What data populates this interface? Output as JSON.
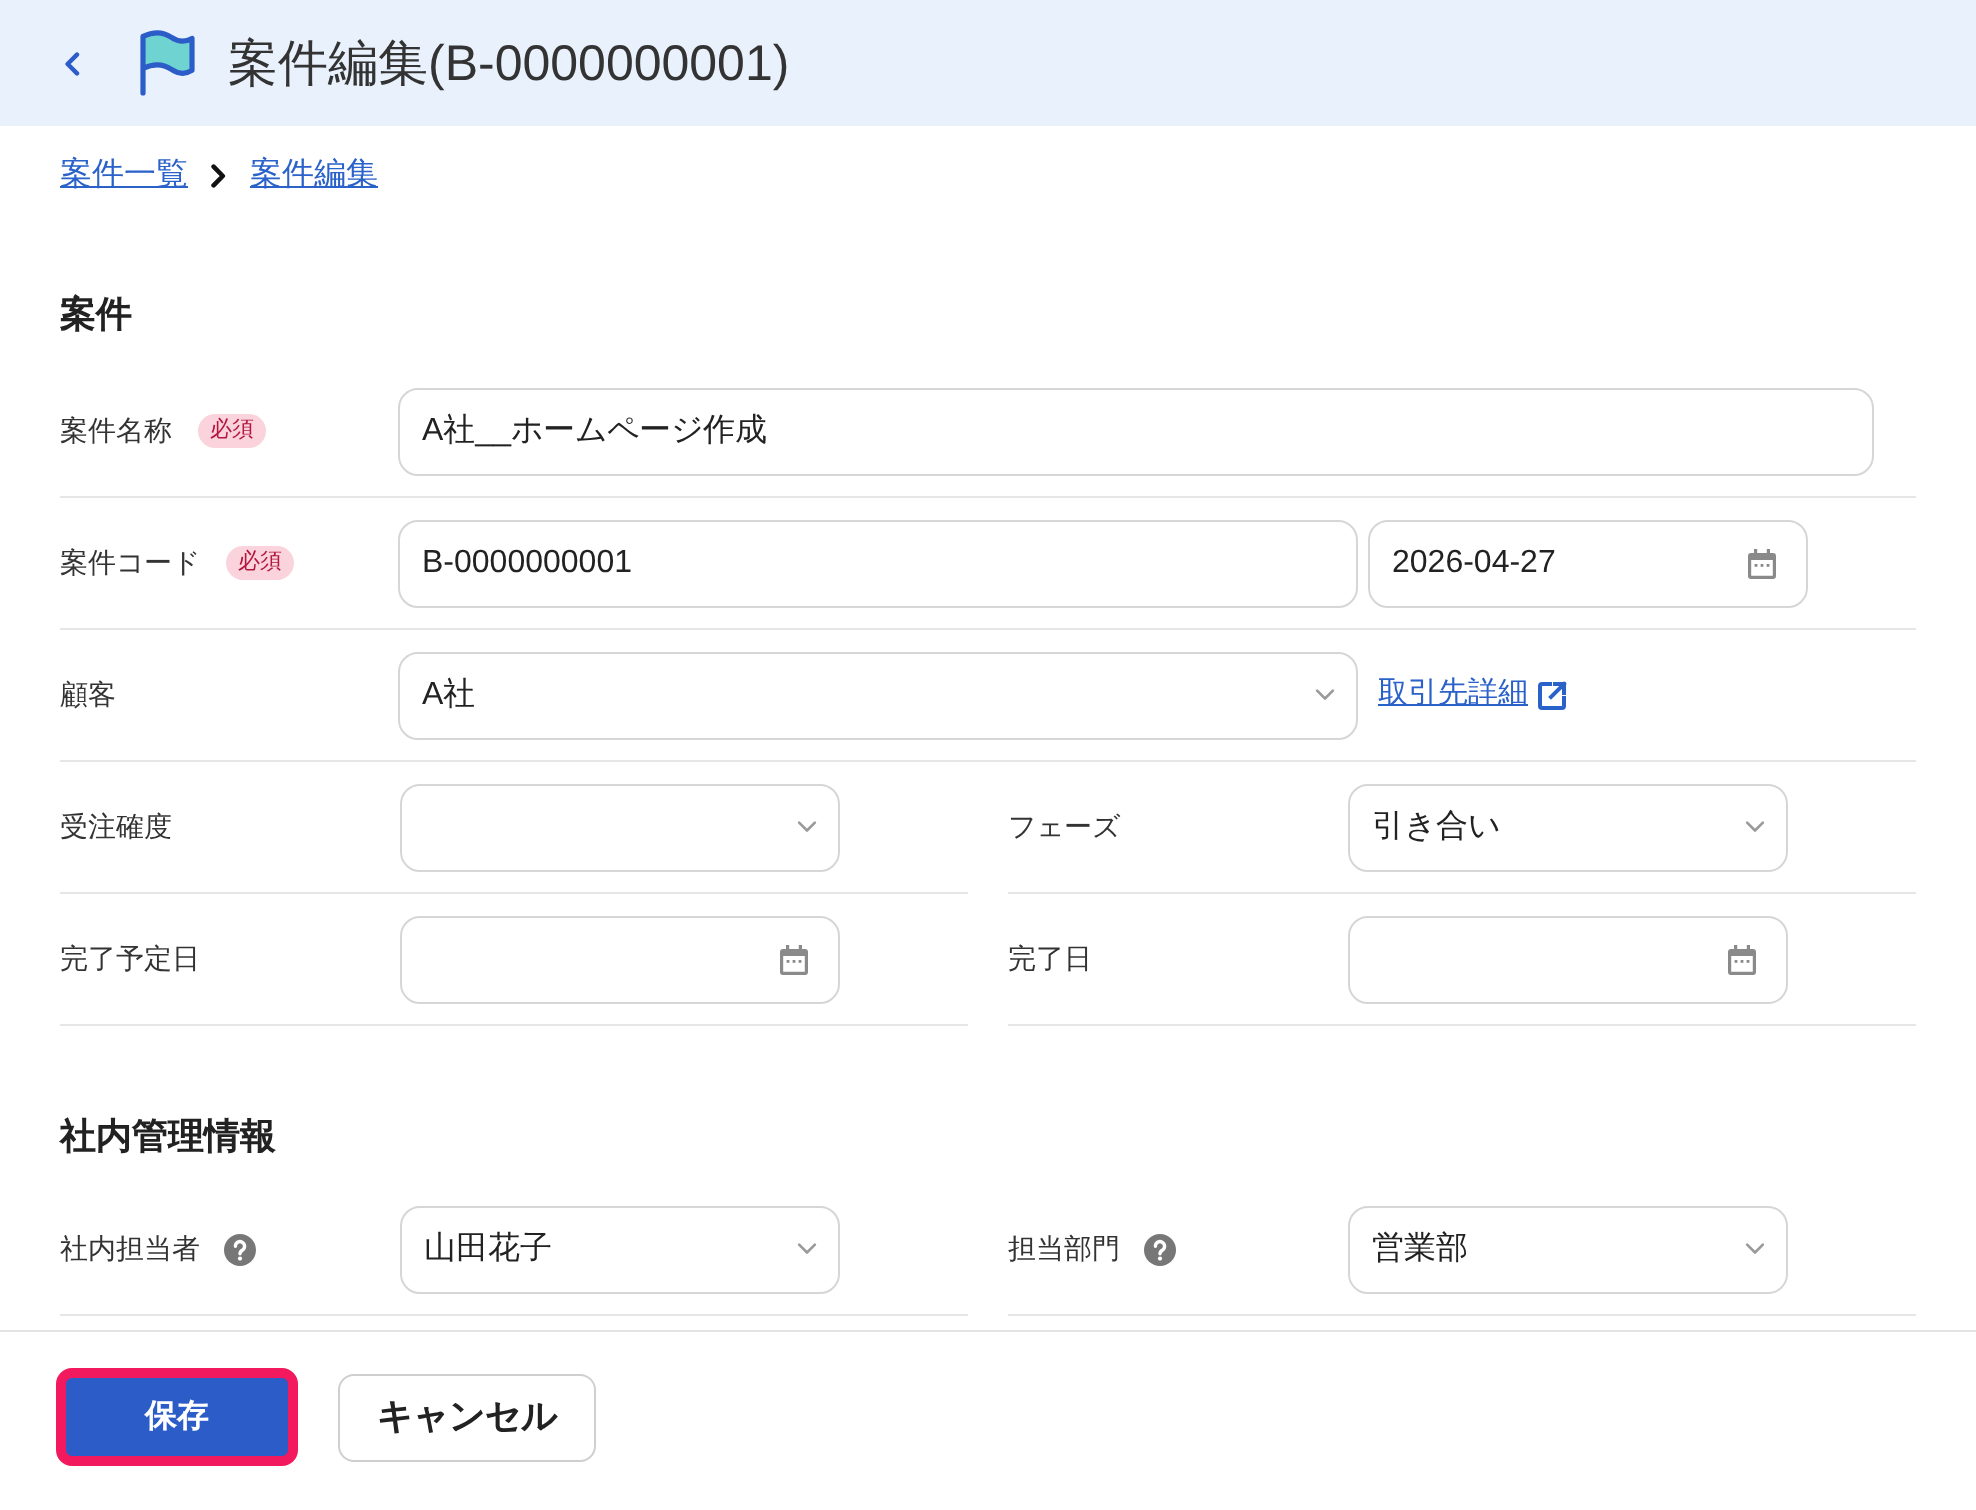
{
  "header": {
    "title": "案件編集(B-0000000001)"
  },
  "breadcrumb": [
    {
      "label": "案件一覧"
    },
    {
      "label": "案件編集"
    }
  ],
  "sections": [
    {
      "title": "案件",
      "rows": [
        {
          "kind": "single",
          "fields": [
            {
              "label": "案件名称",
              "required_badge": "必須",
              "controls": [
                {
                  "kind": "text",
                  "value": "A社__ホームページ作成"
                }
              ]
            }
          ]
        },
        {
          "kind": "single",
          "fields": [
            {
              "label": "案件コード",
              "required_badge": "必須",
              "controls": [
                {
                  "kind": "text",
                  "value": "B-0000000001"
                },
                {
                  "kind": "date",
                  "value": "2026-04-27"
                }
              ]
            }
          ]
        },
        {
          "kind": "single",
          "fields": [
            {
              "label": "顧客",
              "controls": [
                {
                  "kind": "select",
                  "value": "A社"
                },
                {
                  "kind": "link",
                  "label": "取引先詳細"
                }
              ]
            }
          ]
        },
        {
          "kind": "pair",
          "fields": [
            {
              "label": "受注確度",
              "controls": [
                {
                  "kind": "select"
                }
              ]
            },
            {
              "label": "フェーズ",
              "controls": [
                {
                  "kind": "select",
                  "value": "引き合い"
                }
              ]
            }
          ]
        },
        {
          "kind": "pair",
          "fields": [
            {
              "label": "完了予定日",
              "controls": [
                {
                  "kind": "date"
                }
              ]
            },
            {
              "label": "完了日",
              "controls": [
                {
                  "kind": "date"
                }
              ]
            }
          ]
        }
      ]
    },
    {
      "title": "社内管理情報",
      "rows": [
        {
          "kind": "pair",
          "fields": [
            {
              "label": "社内担当者",
              "help": true,
              "controls": [
                {
                  "kind": "select",
                  "value": "山田花子"
                }
              ]
            },
            {
              "label": "担当部門",
              "help": true,
              "controls": [
                {
                  "kind": "select",
                  "value": "営業部"
                }
              ]
            }
          ]
        }
      ]
    }
  ],
  "buttons": [
    {
      "label": "保存",
      "kind": "primary",
      "highlighted": true
    },
    {
      "label": "キャンセル",
      "kind": "secondary",
      "highlighted": false
    }
  ]
}
